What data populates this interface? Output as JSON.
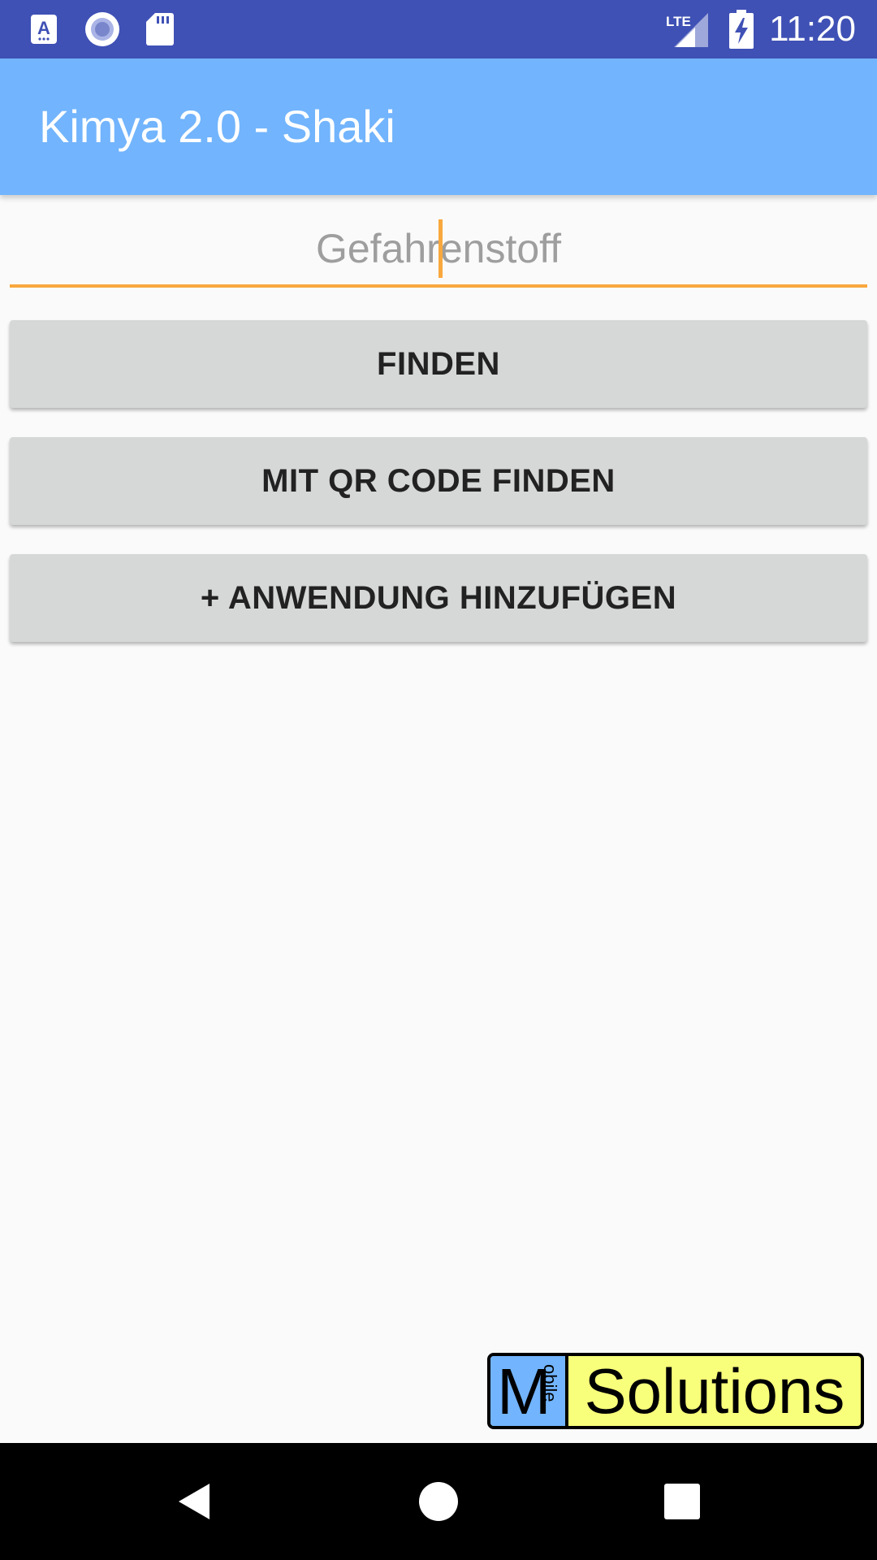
{
  "status_bar": {
    "time": "11:20",
    "network_label": "LTE",
    "icons": [
      "a-notification-icon",
      "circle-notification-icon",
      "sd-card-icon",
      "lte-signal-icon",
      "battery-charging-icon"
    ]
  },
  "app_bar": {
    "title": "Kimya 2.0 - Shaki"
  },
  "search": {
    "placeholder": "Gefahrenstoff",
    "value": ""
  },
  "buttons": {
    "find": "FINDEN",
    "qr_find": "MIT QR CODE FINDEN",
    "add_application": "+ ANWENDUNG HINZUFÜGEN"
  },
  "logo": {
    "m": "M",
    "obile": "obile",
    "solutions": "Solutions"
  },
  "nav_bar": {
    "icons": [
      "back-icon",
      "home-icon",
      "recents-icon"
    ]
  },
  "colors": {
    "status_bar": "#3f51b5",
    "app_bar": "#72b4fd",
    "accent": "#f9a83e",
    "button": "#d6d7d7",
    "background": "#fafafa",
    "logo_yellow": "#f8ff7a",
    "logo_blue": "#72b4fd"
  }
}
